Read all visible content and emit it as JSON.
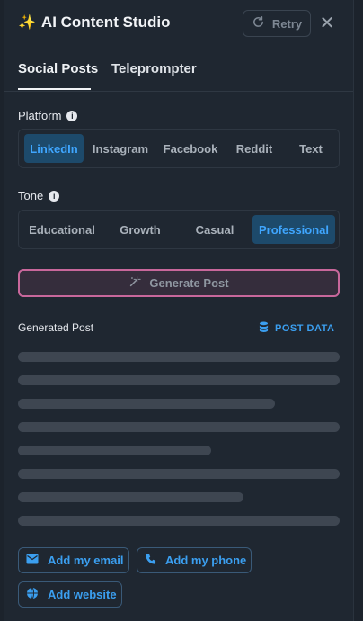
{
  "header": {
    "title_icon": "sparkle",
    "title": "AI Content Studio",
    "retry_label": "Retry",
    "close_glyph": "✕"
  },
  "tabs": [
    {
      "label": "Social Posts",
      "active": true
    },
    {
      "label": "Teleprompter",
      "active": false
    }
  ],
  "platform": {
    "label": "Platform",
    "options": [
      "LinkedIn",
      "Instagram",
      "Facebook",
      "Reddit",
      "Text"
    ],
    "selected": "LinkedIn"
  },
  "tone": {
    "label": "Tone",
    "options": [
      "Educational",
      "Growth",
      "Casual",
      "Professional"
    ],
    "selected": "Professional"
  },
  "generate": {
    "label": "Generate Post"
  },
  "generated": {
    "label": "Generated Post",
    "post_data_label": "POST DATA"
  },
  "actions": {
    "email": "Add my email",
    "phone": "Add my phone",
    "website": "Add website"
  },
  "colors": {
    "accent": "#3b9ff0",
    "active_bg": "#1d4a6b",
    "generate_border": "#c8679b",
    "panel_bg": "#1f2731"
  }
}
